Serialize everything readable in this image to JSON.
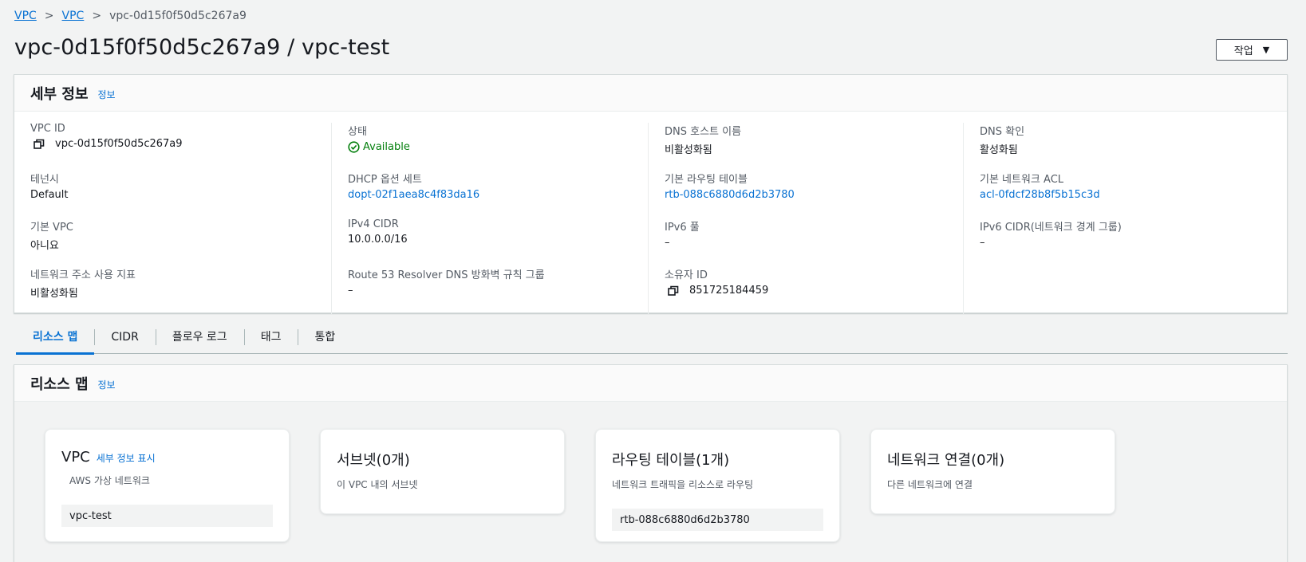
{
  "breadcrumb": {
    "items": [
      "VPC",
      "VPC"
    ],
    "separator": ">",
    "current": "vpc-0d15f0f50d5c267a9"
  },
  "page": {
    "title": "vpc-0d15f0f50d5c267a9 / vpc-test",
    "action_label": "작업",
    "action_caret": "▼"
  },
  "details": {
    "title": "세부 정보",
    "info_label": "정보",
    "fields": {
      "vpc_id": {
        "label": "VPC ID",
        "value": "vpc-0d15f0f50d5c267a9"
      },
      "tenancy": {
        "label": "테넌시",
        "value": "Default"
      },
      "default_vpc": {
        "label": "기본 VPC",
        "value": "아니요"
      },
      "net_addr_usage": {
        "label": "네트워크 주소 사용 지표",
        "value": "비활성화됨"
      },
      "state": {
        "label": "상태",
        "value": "Available"
      },
      "dhcp": {
        "label": "DHCP 옵션 세트",
        "value": "dopt-02f1aea8c4f83da16"
      },
      "ipv4_cidr": {
        "label": "IPv4 CIDR",
        "value": "10.0.0.0/16"
      },
      "route53": {
        "label": "Route 53 Resolver DNS 방화벽 규칙 그룹",
        "value": "–"
      },
      "dns_hostnames": {
        "label": "DNS 호스트 이름",
        "value": "비활성화됨"
      },
      "main_route_table": {
        "label": "기본 라우팅 테이블",
        "value": "rtb-088c6880d6d2b3780"
      },
      "ipv6_pool": {
        "label": "IPv6 풀",
        "value": "–"
      },
      "owner_id": {
        "label": "소유자 ID",
        "value": "851725184459"
      },
      "dns_resolution": {
        "label": "DNS 확인",
        "value": "활성화됨"
      },
      "main_acl": {
        "label": "기본 네트워크 ACL",
        "value": "acl-0fdcf28b8f5b15c3d"
      },
      "ipv6_cidr": {
        "label": "IPv6 CIDR(네트워크 경계 그룹)",
        "value": "–"
      }
    },
    "colors": {
      "link": "#0972d3",
      "success": "#037f0c"
    }
  },
  "tabs": [
    {
      "label": "리소스 맵",
      "active": true
    },
    {
      "label": "CIDR",
      "active": false
    },
    {
      "label": "플로우 로그",
      "active": false
    },
    {
      "label": "태그",
      "active": false
    },
    {
      "label": "통합",
      "active": false
    }
  ],
  "resource_map": {
    "title": "리소스 맵",
    "info_label": "정보",
    "cards": {
      "vpc": {
        "title": "VPC",
        "link": "세부 정보 표시",
        "subtitle": "AWS 가상 네트워크",
        "item": "vpc-test"
      },
      "subnets": {
        "title": "서브넷(0개)",
        "subtitle": "이 VPC 내의 서브넷"
      },
      "route_tables": {
        "title": "라우팅 테이블(1개)",
        "subtitle": "네트워크 트래픽을 리소스로 라우팅",
        "item": "rtb-088c6880d6d2b3780"
      },
      "network_connections": {
        "title": "네트워크 연결(0개)",
        "subtitle": "다른 네트워크에 연결"
      }
    }
  }
}
